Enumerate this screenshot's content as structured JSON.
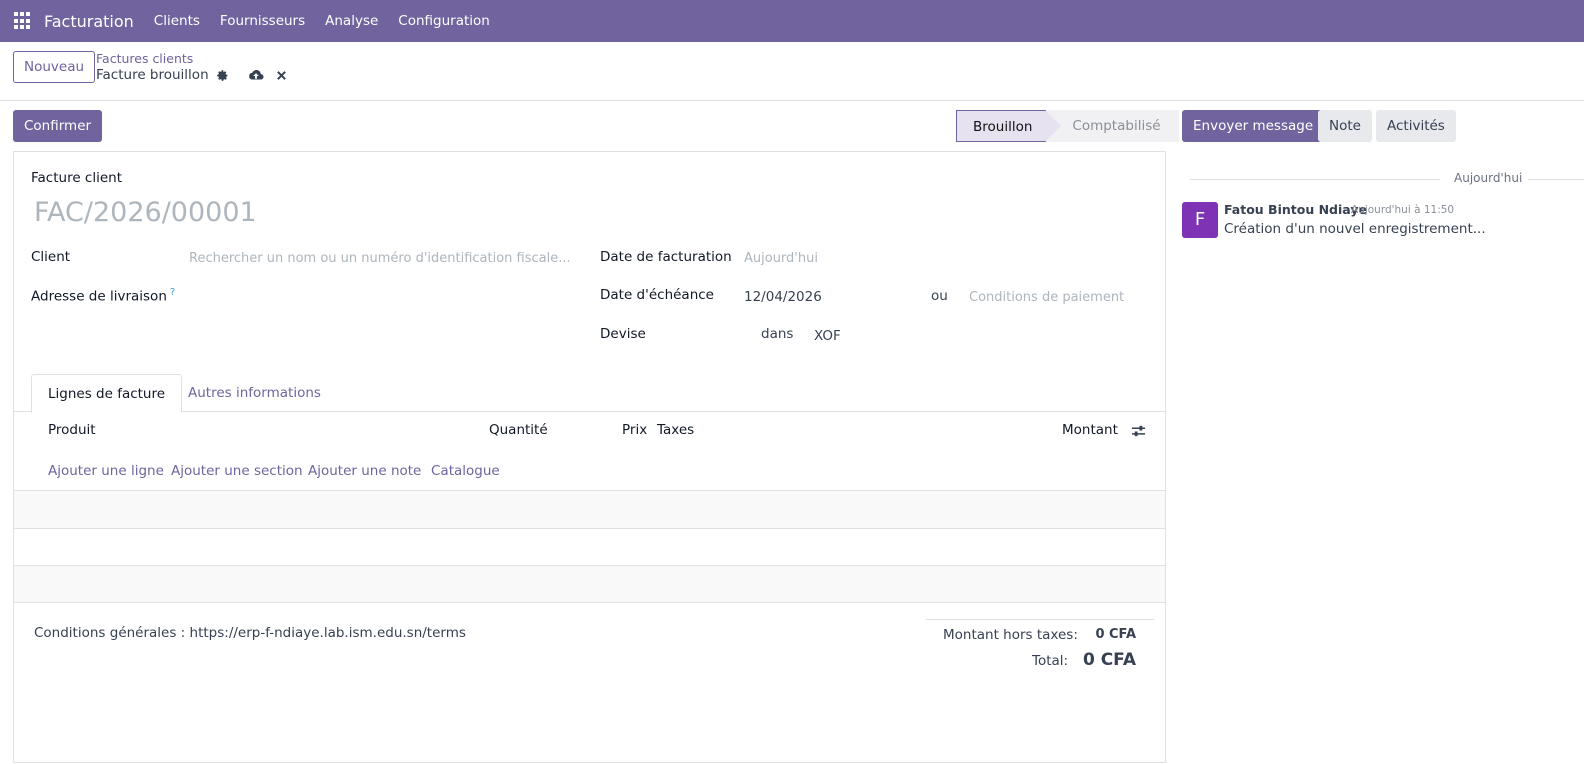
{
  "app": {
    "brand": "Facturation",
    "menu": [
      "Clients",
      "Fournisseurs",
      "Analyse",
      "Configuration"
    ]
  },
  "control": {
    "new_button": "Nouveau",
    "breadcrumb_parent": "Factures clients",
    "breadcrumb_current": "Facture brouillon"
  },
  "actions": {
    "confirm": "Confirmer",
    "status_steps": [
      "Brouillon",
      "Comptabilisé"
    ],
    "status_current": "Brouillon"
  },
  "form": {
    "type_label": "Facture client",
    "number": "FAC/2026/00001",
    "client_label": "Client",
    "client_placeholder": "Rechercher un nom ou un numéro d'identification fiscale...",
    "delivery_label": "Adresse de livraison",
    "delivery_help": "?",
    "invoice_date_label": "Date de facturation",
    "invoice_date_placeholder": "Aujourd'hui",
    "due_date_label": "Date d'échéance",
    "due_date_value": "12/04/2026",
    "or_label": "ou",
    "payment_terms_placeholder": "Conditions de paiement",
    "currency_label": "Devise",
    "currency_in": "dans",
    "currency_value": "XOF"
  },
  "tabs": [
    "Lignes de facture",
    "Autres informations"
  ],
  "lines": {
    "columns": {
      "product": "Produit",
      "quantity": "Quantité",
      "price": "Prix",
      "taxes": "Taxes",
      "amount": "Montant"
    },
    "add_links": [
      "Ajouter une ligne",
      "Ajouter une section",
      "Ajouter une note",
      "Catalogue"
    ]
  },
  "footer": {
    "terms": "Conditions générales : https://erp-f-ndiaye.lab.ism.edu.sn/terms",
    "untaxed_label": "Montant hors taxes:",
    "untaxed_value": "0 CFA",
    "total_label": "Total:",
    "total_value": "0 CFA"
  },
  "chatter": {
    "send_message": "Envoyer message",
    "note": "Note",
    "activities": "Activités",
    "day_separator": "Aujourd'hui",
    "message": {
      "avatar_letter": "F",
      "author": "Fatou Bintou Ndiaye",
      "date": "Aujourd'hui à 11:50",
      "body": "Création d'un nouvel enregistrement..."
    }
  },
  "colors": {
    "brand": "#71639e",
    "avatar": "#7e32b4"
  }
}
